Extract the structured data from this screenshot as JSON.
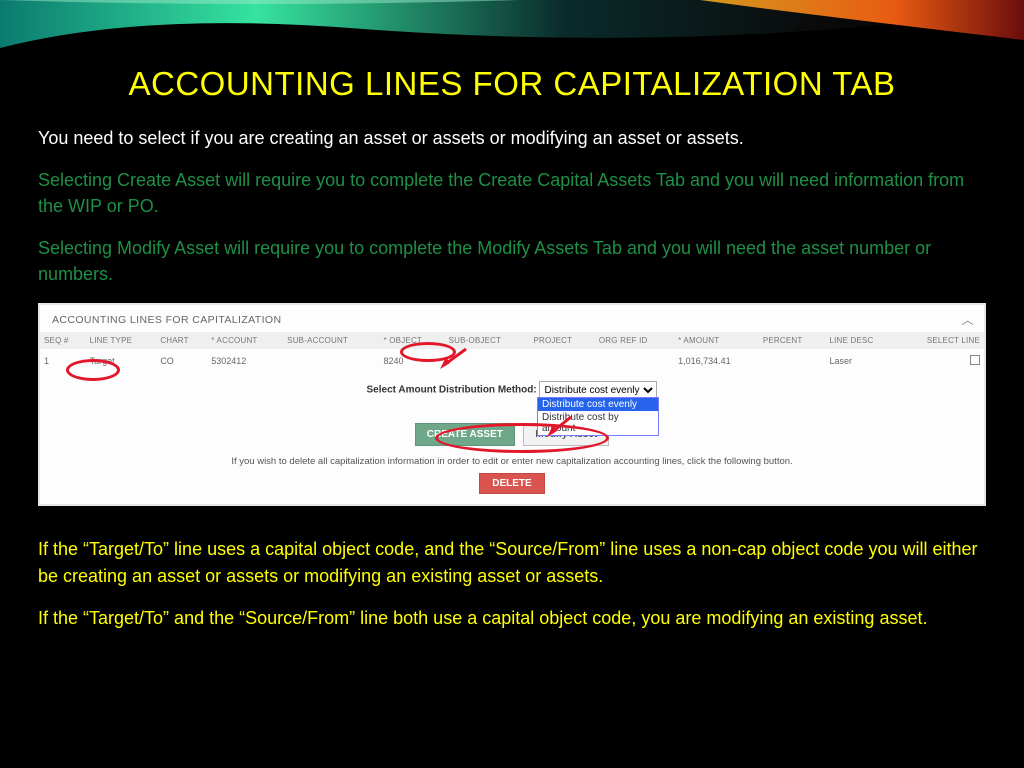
{
  "title": "ACCOUNTING LINES FOR CAPITALIZATION TAB",
  "intro": "You need to select if you are creating an asset or assets or modifying an asset or assets.",
  "create_note": "Selecting Create Asset will require you to complete the Create Capital Assets Tab and you will need information from the WIP or PO.",
  "modify_note": "Selecting Modify Asset will require you to complete the Modify Assets Tab and you will need the asset number or numbers.",
  "panel": {
    "header": "ACCOUNTING LINES FOR CAPITALIZATION",
    "columns": {
      "seq": "SEQ #",
      "line_type": "LINE TYPE",
      "chart": "CHART",
      "account": "* ACCOUNT",
      "sub_account": "SUB-ACCOUNT",
      "object": "* OBJECT",
      "sub_object": "SUB-OBJECT",
      "project": "PROJECT",
      "org_ref": "ORG REF ID",
      "amount": "* AMOUNT",
      "percent": "PERCENT",
      "line_desc": "LINE DESC",
      "select_line": "SELECT LINE"
    },
    "row": {
      "seq": "1",
      "line_type": "Target",
      "chart": "CO",
      "account": "5302412",
      "sub_account": "",
      "object": "8240",
      "sub_object": "",
      "project": "",
      "org_ref": "",
      "amount": "1,016,734.41",
      "percent": "",
      "line_desc": "Laser"
    },
    "distribution": {
      "label": "Select Amount Distribution Method:",
      "selected": "Distribute cost evenly",
      "opt1": "Distribute cost evenly",
      "opt2": "Distribute cost by amount"
    },
    "buttons": {
      "create": "CREATE ASSET",
      "modify": "Modify Asset",
      "delete": "DELETE"
    },
    "delete_note": "If you wish to delete all capitalization information in order to edit or enter new capitalization accounting lines, click the following button."
  },
  "foot1": "If the “Target/To” line uses a capital object code, and the “Source/From” line uses a non-cap object code you will either be creating an asset or assets or modifying an existing asset or assets.",
  "foot2": "If the “Target/To” and the “Source/From” line both use a capital object code, you are modifying an existing asset."
}
